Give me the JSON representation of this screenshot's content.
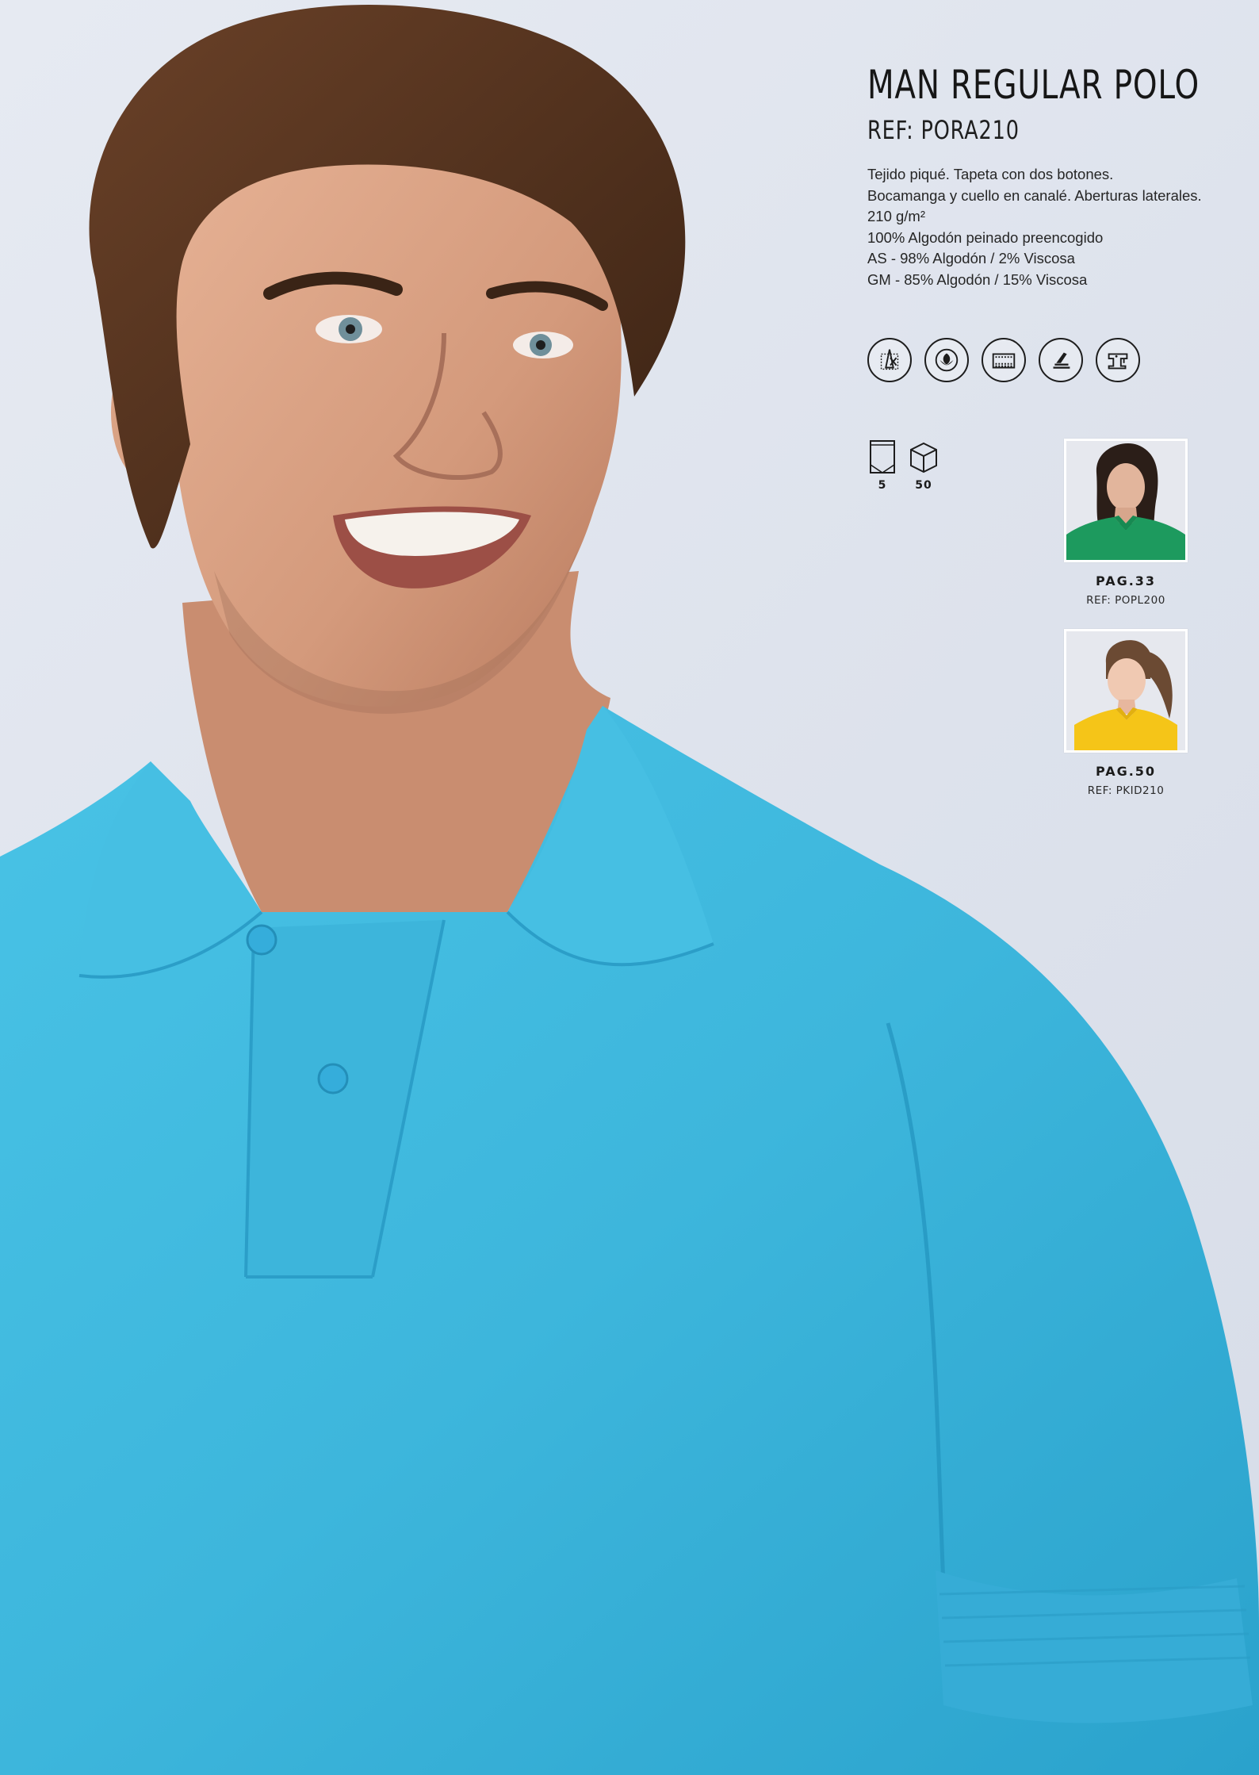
{
  "product": {
    "title": "MAN REGULAR POLO",
    "reference": "REF: PORA210",
    "description": [
      "Tejido piqué. Tapeta con dos botones.",
      "Bocamanga y cuello en canalé. Aberturas laterales.",
      "210 g/m²",
      "100% Algodón peinado preencogido",
      "AS - 98% Algodón / 2% Viscosa",
      "GM - 85% Algodón / 15% Viscosa"
    ],
    "shirt_color": "#3fb8dd"
  },
  "care_icons": [
    "no-bleach-icon",
    "cotton-flower-icon",
    "ribbed-cuff-icon",
    "preshrunk-press-icon",
    "sewing-machine-icon"
  ],
  "packaging": {
    "bag_units": "5",
    "box_units": "50"
  },
  "related_products": [
    {
      "page": "PAG.33",
      "ref": "REF: POPL200",
      "color": "#1d9a5e"
    },
    {
      "page": "PAG.50",
      "ref": "REF: PKID210",
      "color": "#f5c518"
    }
  ]
}
